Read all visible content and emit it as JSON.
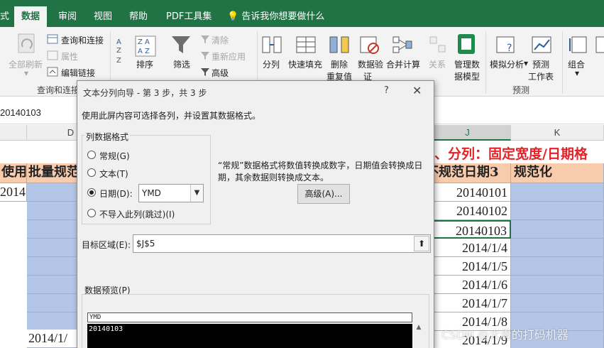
{
  "ribbon": {
    "tabs": [
      "式",
      "数据",
      "审阅",
      "视图",
      "帮助",
      "PDF工具集",
      "告诉我你想要做什么"
    ],
    "active_tab": "数据",
    "buttons": {
      "refresh_all": "全部刷新",
      "queries_connections": "查询和连接",
      "properties": "属性",
      "edit_links": "编辑链接",
      "sort": "排序",
      "filter": "筛选",
      "clear": "清除",
      "reapply": "重新应用",
      "advanced": "高级",
      "text_to_columns": "分列",
      "flash_fill": "快速填充",
      "remove_duplicates": [
        "删除",
        "重复值"
      ],
      "data_validation": [
        "数据验",
        "证"
      ],
      "consolidate": "合并计算",
      "relationships": "关系",
      "manage_model": [
        "管理数",
        "据模型"
      ],
      "what_if": "模拟分析",
      "forecast_sheet": [
        "预测",
        "工作表"
      ],
      "group": "组合"
    },
    "group_labels": {
      "queries": "查询和连接",
      "forecast": "预测"
    }
  },
  "formula_bar": {
    "name_value": "20140103"
  },
  "grid": {
    "col_d": "D",
    "col_j": "J",
    "col_k": "K",
    "banner": "、分列：固定宽度/日期格",
    "header_left_a": "使用",
    "header_left_b": "批量规范",
    "header_j": "不规范日期3",
    "header_k": "规范化",
    "a_value": "2014",
    "d_bottom": "2014/1/",
    "j_values": [
      "20140101",
      "20140102",
      "20140103",
      "2014/1/4",
      "2014/1/5",
      "2014/1/6",
      "2014/1/7",
      "2014/1/8",
      "2014/1/9"
    ]
  },
  "dialog": {
    "title": "文本分列向导 - 第 3 步，共 3 步",
    "help": "?",
    "close": "✕",
    "instruction": "使用此屏内容可选择各列，并设置其数据格式。",
    "format_group": "列数据格式",
    "options": [
      "常规(G)",
      "文本(T)",
      "日期(D):",
      "不导入此列(跳过)(I)"
    ],
    "date_format": "YMD",
    "description": [
      "“常规”数据格式将数值转换成数字，日期值会转换成日",
      "期，其余数据则转换成文本。"
    ],
    "advanced_button": "高级(A)...",
    "destination_label": "目标区域(E):",
    "destination_value": "$J$5",
    "preview_label": "数据预览(P)",
    "preview_header": "YMD",
    "preview_first_row": "20140103"
  },
  "watermark": "CSDN @大青的打码机器"
}
